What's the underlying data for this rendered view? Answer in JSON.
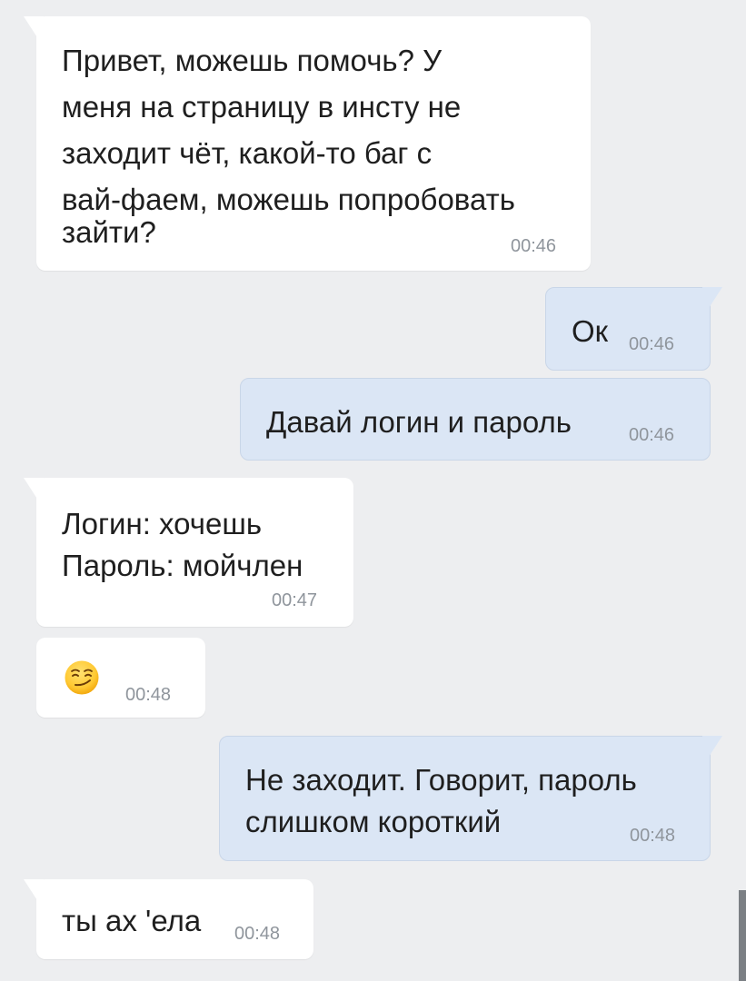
{
  "messages": [
    {
      "direction": "incoming",
      "lines": [
        "Привет, можешь помочь? У",
        "меня на страницу в инсту не",
        "заходит чёт, какой-то баг с",
        "вай-фаем, можешь попробовать",
        "зайти?"
      ],
      "time": "00:46"
    },
    {
      "direction": "outgoing",
      "lines": [
        "Ок"
      ],
      "time": "00:46"
    },
    {
      "direction": "outgoing",
      "lines": [
        "Давай логин и пароль"
      ],
      "time": "00:46"
    },
    {
      "direction": "incoming",
      "lines": [
        "Логин: хочешь",
        "Пароль: мойчлен"
      ],
      "time": "00:47"
    },
    {
      "direction": "incoming",
      "emoji": "smirking-face-emoji",
      "time": "00:48"
    },
    {
      "direction": "outgoing",
      "lines": [
        "Не заходит. Говорит, пароль",
        "слишком короткий"
      ],
      "time": "00:48"
    },
    {
      "direction": "incoming",
      "lines": [
        "ты ах 'ела"
      ],
      "time": "00:48"
    }
  ],
  "colors": {
    "background": "#edeef0",
    "incoming_bubble": "#ffffff",
    "outgoing_bubble": "#dbe6f5",
    "timestamp": "#8f959c",
    "text": "#1f1f1f"
  }
}
